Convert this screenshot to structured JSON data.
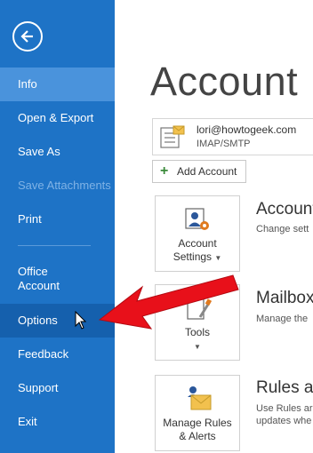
{
  "sidebar": {
    "items": [
      {
        "label": "Info"
      },
      {
        "label": "Open & Export"
      },
      {
        "label": "Save As"
      },
      {
        "label": "Save Attachments"
      },
      {
        "label": "Print"
      },
      {
        "label_line1": "Office",
        "label_line2": "Account"
      },
      {
        "label": "Options"
      },
      {
        "label": "Feedback"
      },
      {
        "label": "Support"
      },
      {
        "label": "Exit"
      }
    ]
  },
  "main": {
    "title": "Account Inf",
    "account": {
      "email": "lori@howtogeek.com",
      "type": "IMAP/SMTP"
    },
    "add_account_label": "Add Account",
    "tiles": [
      {
        "line1": "Account",
        "line2": "Settings"
      },
      {
        "line1": "Tools"
      },
      {
        "line1": "Manage Rules",
        "line2": "& Alerts"
      }
    ],
    "sections": [
      {
        "title": "Account",
        "desc1": "Change sett"
      },
      {
        "title": "Mailbox",
        "desc1": "Manage the"
      },
      {
        "title": "Rules ar",
        "desc1": "Use Rules ar",
        "desc2": "updates whe"
      }
    ]
  },
  "colors": {
    "sidebar": "#1e73c6",
    "active": "#4a93dc",
    "arrow": "#e8101a"
  }
}
